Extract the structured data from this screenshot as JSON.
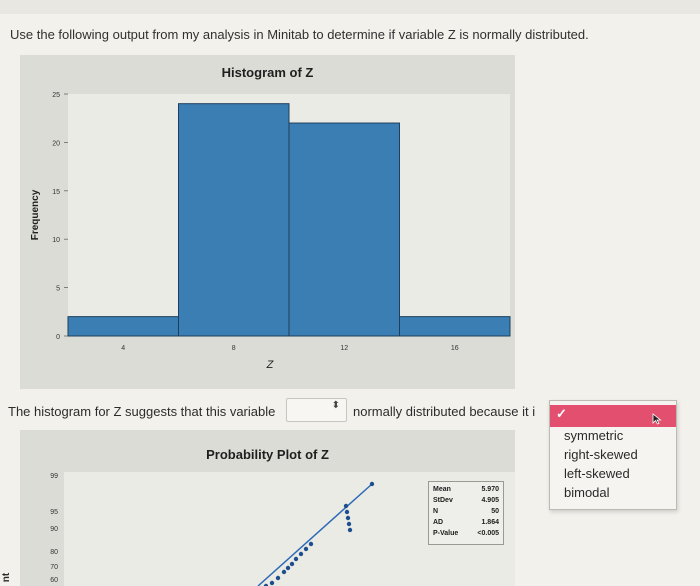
{
  "question": "Use the following output from my analysis in Minitab to determine if variable Z is normally distributed.",
  "histogram": {
    "title": "Histogram of Z",
    "ylabel": "Frequency",
    "xlabel": "Z",
    "y_ticks": [
      "25",
      "20",
      "15",
      "10",
      "5",
      "0"
    ],
    "x_ticks": [
      "4",
      "8",
      "12",
      "16"
    ]
  },
  "sentence": {
    "part1": "The histogram for Z suggests that this variable",
    "part2": "normally distributed because it i"
  },
  "select": {
    "value": "",
    "arrow": "⬍"
  },
  "dropdown": {
    "options": [
      "symmetric",
      "right-skewed",
      "left-skewed",
      "bimodal"
    ]
  },
  "probability_plot": {
    "title": "Probability Plot of Z",
    "y_ticks": [
      "99",
      "95",
      "90",
      "80",
      "70",
      "60"
    ],
    "stats": [
      {
        "label": "Mean",
        "value": "5.970"
      },
      {
        "label": "StDev",
        "value": "4.905"
      },
      {
        "label": "N",
        "value": "50"
      },
      {
        "label": "AD",
        "value": "1.864"
      },
      {
        "label": "P-Value",
        "value": "<0.005"
      }
    ]
  },
  "side_label": "nt",
  "chart_data": {
    "type": "bar",
    "title": "Histogram of Z",
    "xlabel": "Z",
    "ylabel": "Frequency",
    "bins": [
      [
        2,
        6
      ],
      [
        6,
        10
      ],
      [
        10,
        14
      ],
      [
        14,
        18
      ]
    ],
    "values": [
      2,
      24,
      22,
      2
    ],
    "xlim": [
      2,
      18
    ],
    "ylim": [
      0,
      25
    ]
  }
}
